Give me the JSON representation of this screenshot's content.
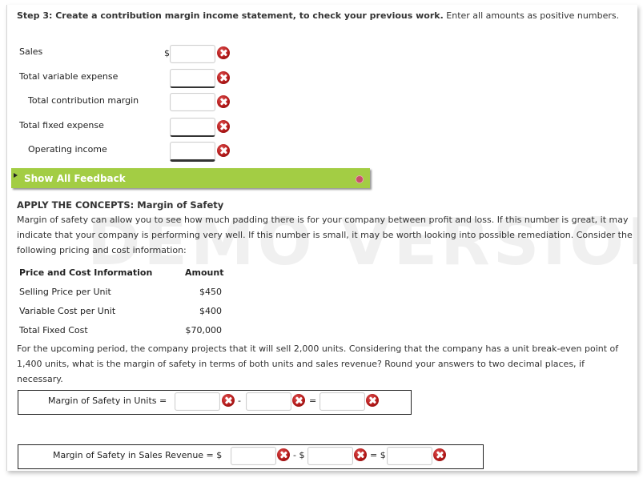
{
  "step3": {
    "bold": "Step 3: Create a contribution margin income statement, to check your previous work.",
    "rest": " Enter all amounts as positive numbers.",
    "rows": [
      {
        "label": "Sales",
        "prefix": "$",
        "value": "",
        "status": "incorrect"
      },
      {
        "label": "Total variable expense",
        "prefix": "",
        "value": "",
        "status": "incorrect"
      },
      {
        "label": "Total contribution margin",
        "prefix": "",
        "value": "",
        "status": "incorrect"
      },
      {
        "label": "Total fixed expense",
        "prefix": "",
        "value": "",
        "status": "incorrect"
      },
      {
        "label": "Operating income",
        "prefix": "",
        "value": "",
        "status": "incorrect"
      }
    ]
  },
  "feedback": {
    "label": "Show All Feedback"
  },
  "apply": {
    "title": "APPLY THE CONCEPTS: Margin of Safety",
    "intro": "Margin of safety can allow you to see how much padding there is for your company between profit and loss. If this number is great, it may indicate that your company is performing very well. If this number is small, it may be worth looking into possible remediation. Consider the following pricing and cost information:",
    "watermark": "DEMO VERSION",
    "table": {
      "headers": [
        "Price and Cost Information",
        "Amount"
      ],
      "rows": [
        [
          "Selling Price per Unit",
          "$450"
        ],
        [
          "Variable Cost per Unit",
          "$400"
        ],
        [
          "Total Fixed Cost",
          "$70,000"
        ]
      ]
    },
    "question": "For the upcoming period, the company projects that it will sell 2,000 units. Considering that the company has a unit break-even point of 1,400 units, what is the margin of safety in terms of both units and sales revenue? Round your answers to two decimal places, if necessary."
  },
  "units_eq": {
    "label": "Margin of Safety in Units =",
    "minus": "-",
    "equals": "=",
    "values": [
      "",
      "",
      ""
    ]
  },
  "revenue_eq": {
    "label": "Margin of Safety in Sales Revenue = $",
    "minus": "- $",
    "equals": "= $",
    "values": [
      "",
      "",
      ""
    ]
  }
}
